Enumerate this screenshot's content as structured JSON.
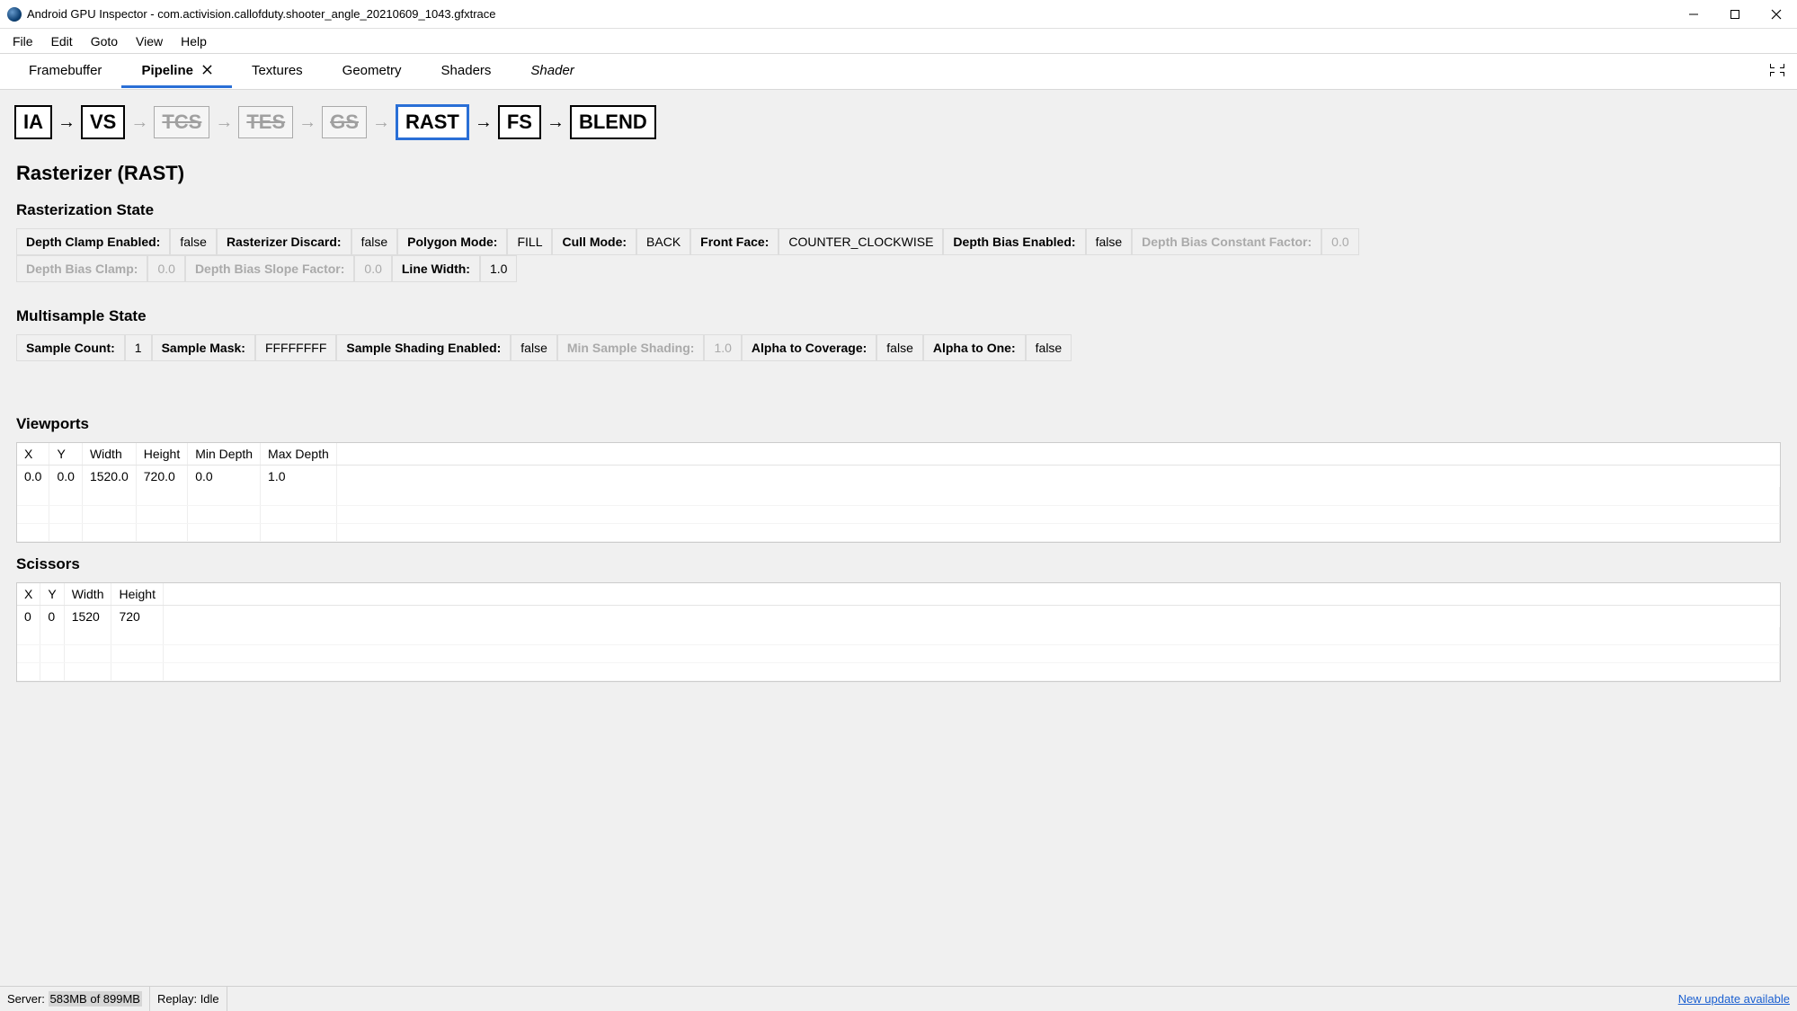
{
  "window": {
    "title": "Android GPU Inspector - com.activision.callofduty.shooter_angle_20210609_1043.gfxtrace"
  },
  "menubar": [
    "File",
    "Edit",
    "Goto",
    "View",
    "Help"
  ],
  "tabs": [
    {
      "label": "Framebuffer",
      "active": false,
      "closable": false
    },
    {
      "label": "Pipeline",
      "active": true,
      "closable": true
    },
    {
      "label": "Textures",
      "active": false,
      "closable": false
    },
    {
      "label": "Geometry",
      "active": false,
      "closable": false
    },
    {
      "label": "Shaders",
      "active": false,
      "closable": false
    },
    {
      "label": "Shader",
      "active": false,
      "closable": false,
      "italic": true
    }
  ],
  "pipeline": {
    "stages": [
      {
        "name": "IA",
        "enabled": true,
        "selected": false
      },
      {
        "name": "VS",
        "enabled": true,
        "selected": false
      },
      {
        "name": "TCS",
        "enabled": false,
        "selected": false
      },
      {
        "name": "TES",
        "enabled": false,
        "selected": false
      },
      {
        "name": "GS",
        "enabled": false,
        "selected": false
      },
      {
        "name": "RAST",
        "enabled": true,
        "selected": true
      },
      {
        "name": "FS",
        "enabled": true,
        "selected": false
      },
      {
        "name": "BLEND",
        "enabled": true,
        "selected": false
      }
    ]
  },
  "page_title": "Rasterizer (RAST)",
  "sections": {
    "rasterization": {
      "title": "Rasterization State",
      "rows": [
        [
          {
            "label": "Depth Clamp Enabled:",
            "value": "false",
            "disabled": false
          },
          {
            "label": "Rasterizer Discard:",
            "value": "false",
            "disabled": false
          },
          {
            "label": "Polygon Mode:",
            "value": "FILL",
            "disabled": false
          },
          {
            "label": "Cull Mode:",
            "value": "BACK",
            "disabled": false
          },
          {
            "label": "Front Face:",
            "value": "COUNTER_CLOCKWISE",
            "disabled": false
          },
          {
            "label": "Depth Bias Enabled:",
            "value": "false",
            "disabled": false
          },
          {
            "label": "Depth Bias Constant Factor:",
            "value": "0.0",
            "disabled": true
          }
        ],
        [
          {
            "label": "Depth Bias Clamp:",
            "value": "0.0",
            "disabled": true
          },
          {
            "label": "Depth Bias Slope Factor:",
            "value": "0.0",
            "disabled": true
          },
          {
            "label": "Line Width:",
            "value": "1.0",
            "disabled": false
          }
        ]
      ]
    },
    "multisample": {
      "title": "Multisample State",
      "rows": [
        [
          {
            "label": "Sample Count:",
            "value": "1",
            "disabled": false
          },
          {
            "label": "Sample Mask:",
            "value": "FFFFFFFF",
            "disabled": false
          },
          {
            "label": "Sample Shading Enabled:",
            "value": "false",
            "disabled": false
          },
          {
            "label": "Min Sample Shading:",
            "value": "1.0",
            "disabled": true
          },
          {
            "label": "Alpha to Coverage:",
            "value": "false",
            "disabled": false
          },
          {
            "label": "Alpha to One:",
            "value": "false",
            "disabled": false
          }
        ]
      ]
    },
    "viewports": {
      "title": "Viewports",
      "headers": [
        "X",
        "Y",
        "Width",
        "Height",
        "Min Depth",
        "Max Depth"
      ],
      "rows": [
        [
          "0.0",
          "0.0",
          "1520.0",
          "720.0",
          "0.0",
          "1.0"
        ]
      ]
    },
    "scissors": {
      "title": "Scissors",
      "headers": [
        "X",
        "Y",
        "Width",
        "Height"
      ],
      "rows": [
        [
          "0",
          "0",
          "1520",
          "720"
        ]
      ]
    }
  },
  "statusbar": {
    "server_label": "Server:",
    "server_value": "583MB of 899MB",
    "replay_label": "Replay:",
    "replay_value": "Idle",
    "update_link": "New update available"
  }
}
